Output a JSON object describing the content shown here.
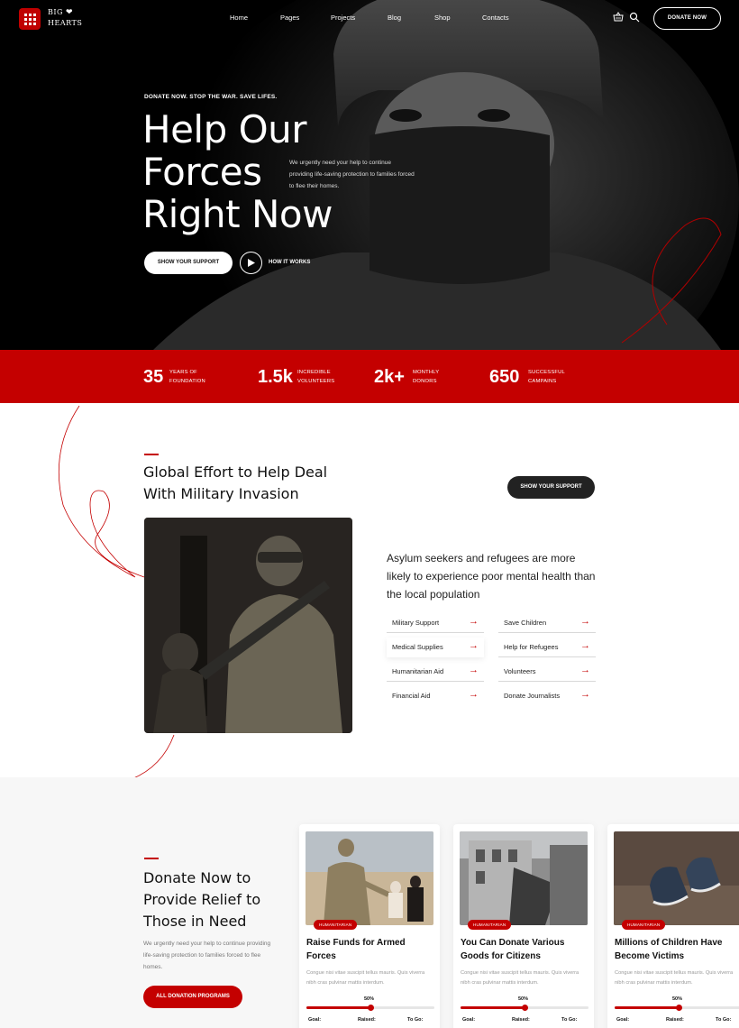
{
  "brand": {
    "name_line1": "BIG",
    "name_line2": "HEARTS",
    "accent": "#c40000"
  },
  "nav": {
    "links": [
      "Home",
      "Pages",
      "Projects",
      "Blog",
      "Shop",
      "Contacts"
    ],
    "cart_icon": "basket-icon",
    "search_icon": "search-icon",
    "donate_label": "DONATE NOW"
  },
  "hero": {
    "eyebrow": "DONATE NOW. STOP THE WAR. SAVE LIFES.",
    "title_line1": "Help Our",
    "title_line2": "Forces",
    "title_line3": "Right Now",
    "description": "We urgently need your help to continue providing life-saving protection to families forced to flee their homes.",
    "primary_button": "SHOW YOUR SUPPORT",
    "secondary_label": "HOW IT WORKS"
  },
  "stats": [
    {
      "value": "35",
      "label_line1": "YEARS OF",
      "label_line2": "FOUNDATION"
    },
    {
      "value": "1.5k",
      "label_line1": "INCREDIBLE",
      "label_line2": "VOLUNTEERS"
    },
    {
      "value": "2k+",
      "label_line1": "MONTHLY",
      "label_line2": "DONORS"
    },
    {
      "value": "650",
      "label_line1": "SUCCESSFUL",
      "label_line2": "CAMPAINS"
    }
  ],
  "effort": {
    "title_line1": "Global Effort to Help Deal",
    "title_line2": "With Military Invasion",
    "button": "SHOW YOUR SUPPORT",
    "lead": "Asylum seekers and refugees are more likely to experience poor mental health than the local population",
    "services": [
      "Military Support",
      "Save Children",
      "Medical Supplies",
      "Help for Refugees",
      "Humanitarian Aid",
      "Volunteers",
      "Financial Aid",
      "Donate Journalists"
    ]
  },
  "programs": {
    "title_line1": "Donate Now to",
    "title_line2": "Provide Relief to",
    "title_line3": "Those in Need",
    "description": "We urgently need your help to continue providing life-saving protection to families forced to flee homes.",
    "button": "ALL DONATION PROGRAMS",
    "cards": [
      {
        "badge": "HUMANITARIAN",
        "title": "Raise Funds for Armed Forces",
        "text": "Congue nisi vitae suscipit tellus mauris. Quis viverra nibh cras pulvinar mattis interdum.",
        "percent_label": "50%",
        "progress": 0.5,
        "goal_label": "Goal:",
        "raised_label": "Raised:",
        "togo_label": "To Go:"
      },
      {
        "badge": "HUMANITARIAN",
        "title": "You Can Donate Various Goods for Citizens",
        "text": "Congue nisi vitae suscipit tellus mauris. Quis viverra nibh cras pulvinar mattis interdum.",
        "percent_label": "50%",
        "progress": 0.5,
        "goal_label": "Goal:",
        "raised_label": "Raised:",
        "togo_label": "To Go:"
      },
      {
        "badge": "HUMANITARIAN",
        "title": "Millions of Children Have Become Victims",
        "text": "Congue nisi vitae suscipit tellus mauris. Quis viverra nibh cras pulvinar mattis interdum.",
        "percent_label": "50%",
        "progress": 0.5,
        "goal_label": "Goal:",
        "raised_label": "Raised:",
        "togo_label": "To Go:"
      }
    ]
  }
}
